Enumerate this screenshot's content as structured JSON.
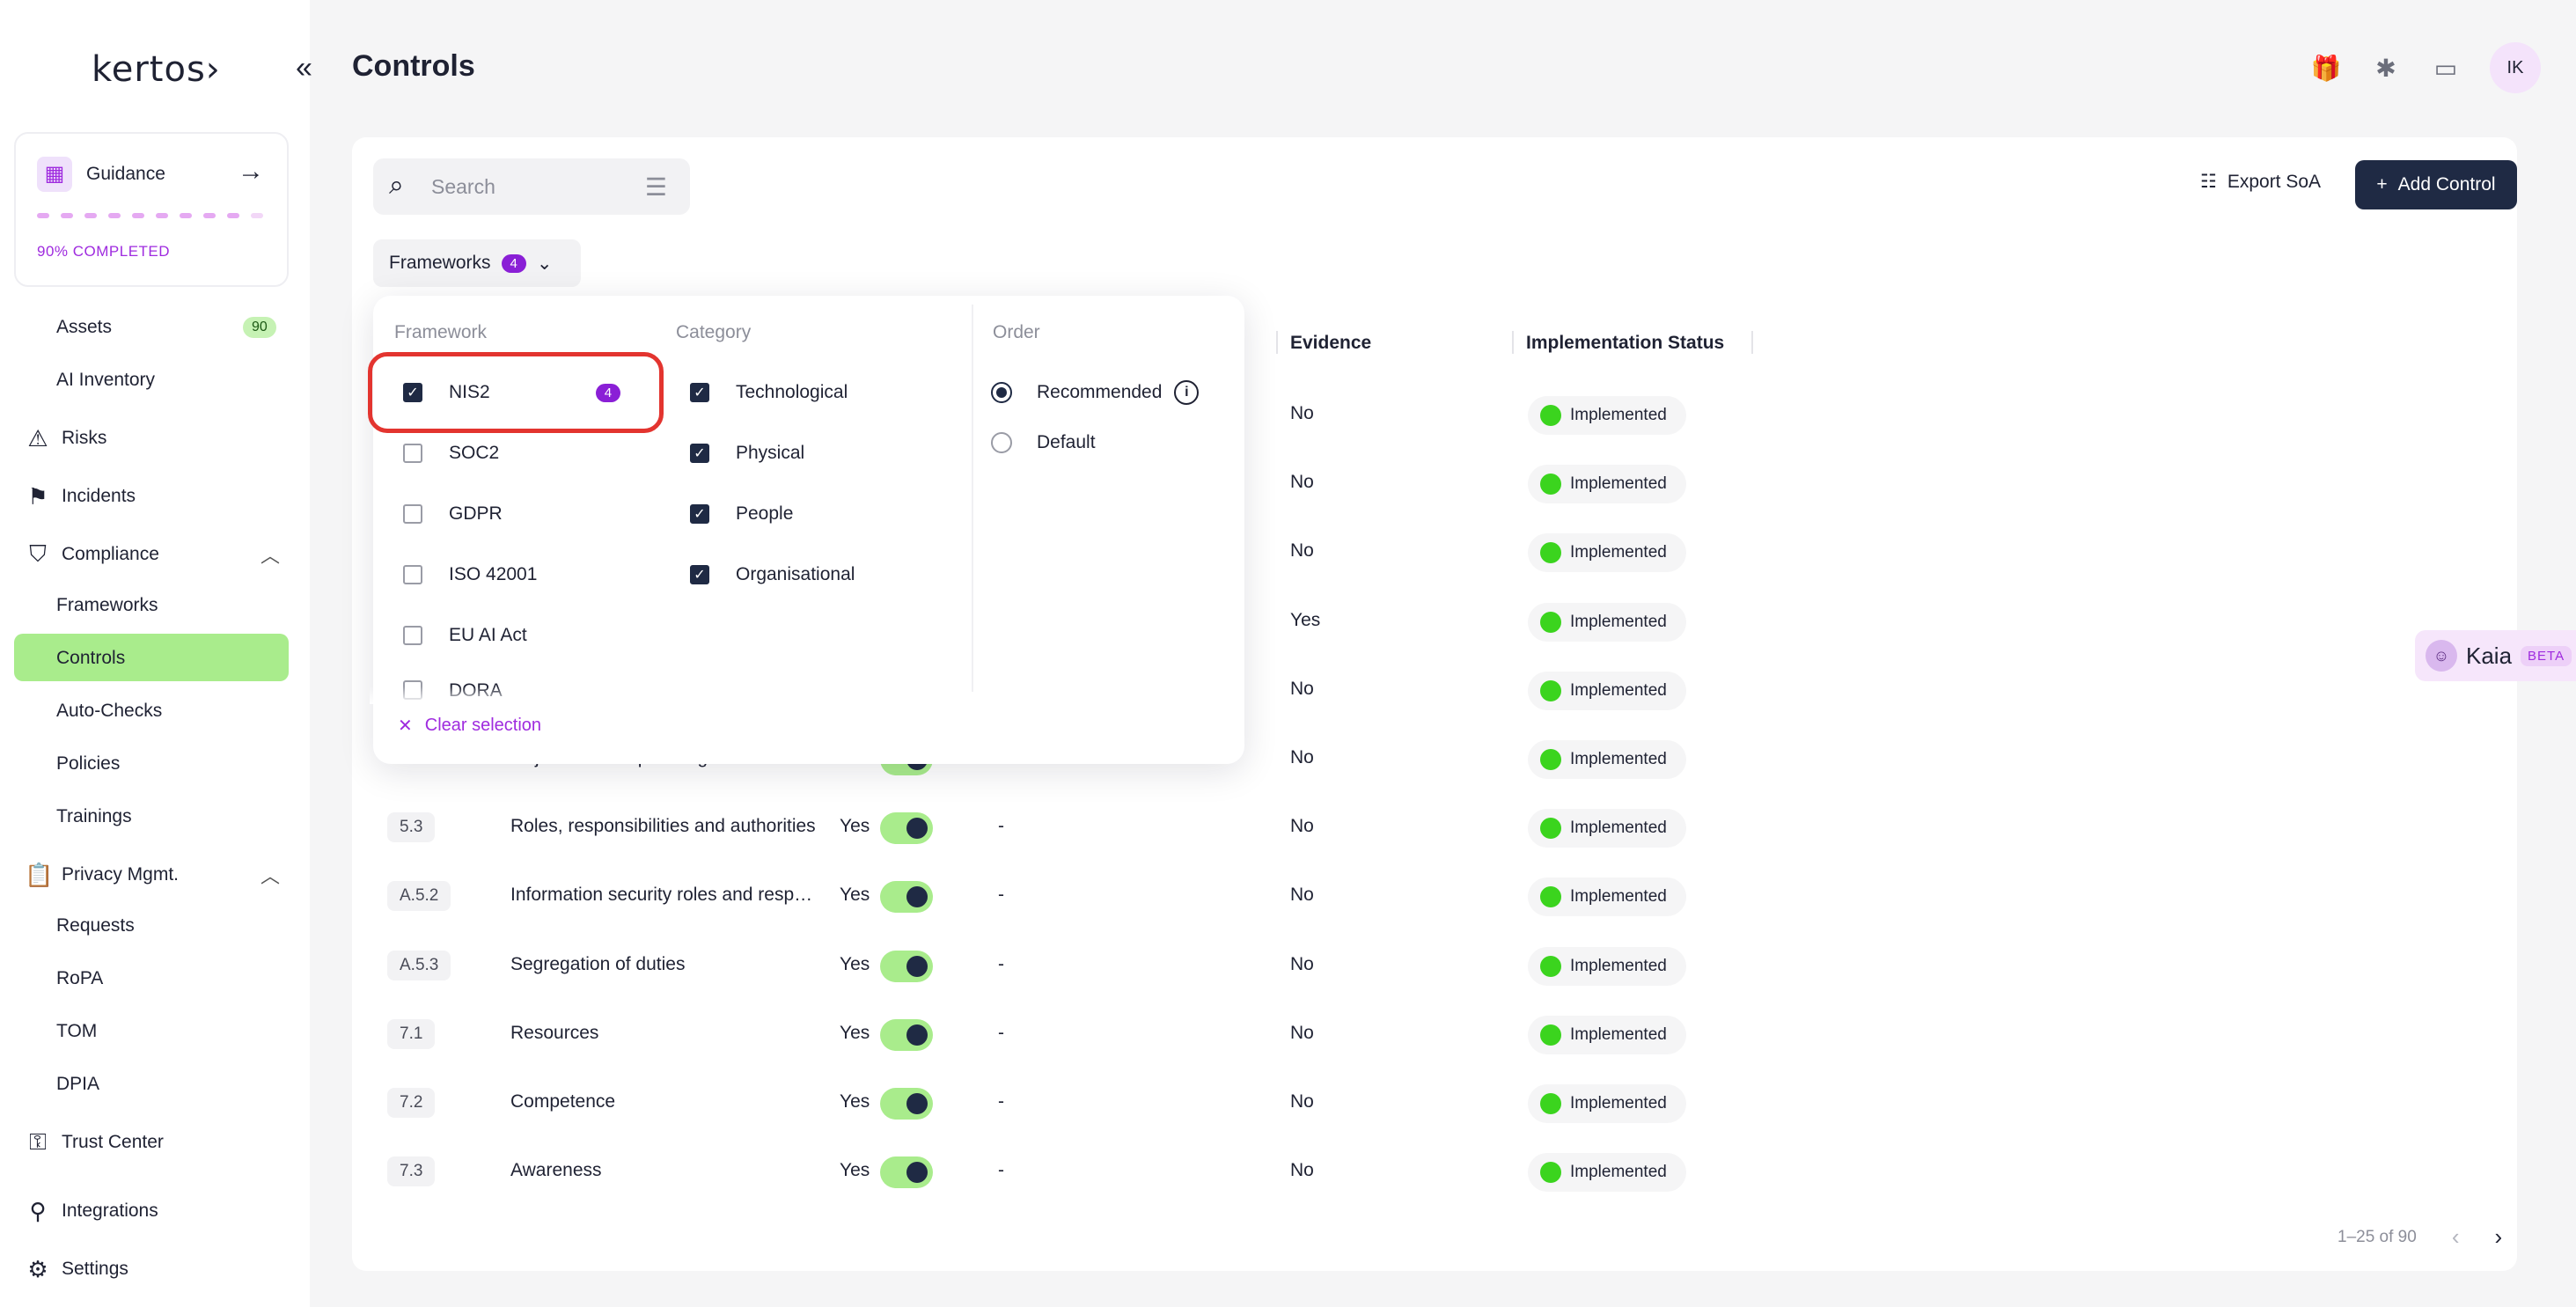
{
  "app": {
    "logo": "kertos›",
    "collapse_glyph": "«"
  },
  "guidance": {
    "title": "Guidance",
    "progress_label": "90% COMPLETED",
    "progress": 0.9
  },
  "sidebar": {
    "assets": {
      "label": "Assets",
      "badge": "90"
    },
    "ai_inventory": "AI Inventory",
    "risks": "Risks",
    "incidents": "Incidents",
    "compliance": "Compliance",
    "frameworks": "Frameworks",
    "controls": "Controls",
    "auto_checks": "Auto-Checks",
    "policies": "Policies",
    "trainings": "Trainings",
    "privacy": "Privacy Mgmt.",
    "requests": "Requests",
    "ropa": "RoPA",
    "tom": "TOM",
    "dpia": "DPIA",
    "trust_center": "Trust Center",
    "integrations": "Integrations",
    "settings": "Settings"
  },
  "header": {
    "title": "Controls",
    "avatar": "IK"
  },
  "toolbar": {
    "search_placeholder": "Search",
    "export_label": "Export SoA",
    "add_label": "Add Control",
    "frameworks_label": "Frameworks",
    "frameworks_count": "4"
  },
  "table": {
    "columns": {
      "evidence": "Evidence",
      "status": "Implementation Status"
    },
    "rows": [
      {
        "code": "",
        "name": "",
        "applicable": "",
        "dash": "",
        "evidence": "No",
        "status": "Implemented"
      },
      {
        "code": "",
        "name": "",
        "applicable": "",
        "dash": "",
        "evidence": "No",
        "status": "Implemented"
      },
      {
        "code": "",
        "name": "",
        "applicable": "",
        "dash": "",
        "evidence": "No",
        "status": "Implemented"
      },
      {
        "code": "",
        "name": "",
        "applicable": "",
        "dash": "",
        "evidence": "Yes",
        "status": "Implemented"
      },
      {
        "code": "",
        "name": "",
        "applicable": "",
        "dash": "",
        "evidence": "No",
        "status": "Implemented"
      },
      {
        "code": "",
        "name": "Objectives and planning to achieve it",
        "applicable": "Yes",
        "dash": "",
        "evidence": "No",
        "status": "Implemented"
      },
      {
        "code": "5.3",
        "name": "Roles, responsibilities and authorities",
        "applicable": "Yes",
        "dash": "-",
        "evidence": "No",
        "status": "Implemented"
      },
      {
        "code": "A.5.2",
        "name": "Information security roles and responsibilities",
        "applicable": "Yes",
        "dash": "-",
        "evidence": "No",
        "status": "Implemented"
      },
      {
        "code": "A.5.3",
        "name": "Segregation of duties",
        "applicable": "Yes",
        "dash": "-",
        "evidence": "No",
        "status": "Implemented"
      },
      {
        "code": "7.1",
        "name": "Resources",
        "applicable": "Yes",
        "dash": "-",
        "evidence": "No",
        "status": "Implemented"
      },
      {
        "code": "7.2",
        "name": "Competence",
        "applicable": "Yes",
        "dash": "-",
        "evidence": "No",
        "status": "Implemented"
      },
      {
        "code": "7.3",
        "name": "Awareness",
        "applicable": "Yes",
        "dash": "-",
        "evidence": "No",
        "status": "Implemented"
      }
    ]
  },
  "pagination": {
    "range": "1–25 of 90"
  },
  "kaia": {
    "name": "Kaia",
    "badge": "BETA"
  },
  "dropdown": {
    "framework_header": "Framework",
    "category_header": "Category",
    "order_header": "Order",
    "frameworks": [
      {
        "label": "NIS2",
        "checked": true,
        "count": "4"
      },
      {
        "label": "SOC2",
        "checked": false
      },
      {
        "label": "GDPR",
        "checked": false
      },
      {
        "label": "ISO 42001",
        "checked": false
      },
      {
        "label": "EU AI Act",
        "checked": false
      },
      {
        "label": "DORA",
        "checked": false
      }
    ],
    "categories": [
      {
        "label": "Technological",
        "checked": true
      },
      {
        "label": "Physical",
        "checked": true
      },
      {
        "label": "People",
        "checked": true
      },
      {
        "label": "Organisational",
        "checked": true
      }
    ],
    "orders": [
      {
        "label": "Recommended",
        "selected": true
      },
      {
        "label": "Default",
        "selected": false
      }
    ],
    "clear_label": "Clear selection"
  }
}
